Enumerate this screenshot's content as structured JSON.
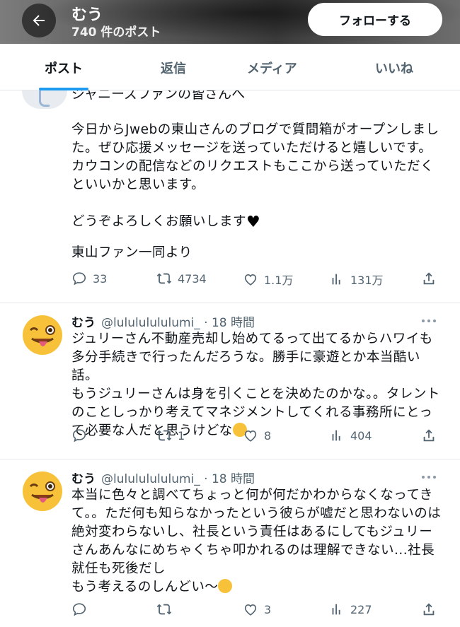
{
  "header": {
    "name": "むう",
    "post_count": "740 件のポスト",
    "follow_label": "フォローする"
  },
  "tabs": [
    "ポスト",
    "返信",
    "メディア",
    "いいね"
  ],
  "tweets": [
    {
      "cut_title": "ジャニーズファンの皆さんへ",
      "text": "今日からJwebの東山さんのブログで質問箱がオープンしました。ぜひ応援メッセージを送っていただけると嬉しいです。カウコンの配信などのリクエストもここから送っていただくといいかと思います。\n\nどうぞよろしくお願いします",
      "text_tail": "東山ファン一同より",
      "replies": "33",
      "reposts": "4734",
      "likes": "1.1万",
      "views": "131万"
    },
    {
      "name": "むう",
      "handle": "@lulululululumi_ · 18 時間",
      "text": "ジュリーさん不動産売却し始めてるって出てるからハワイも多分手続きで行ったんだろうな。勝手に豪遊とか本当酷い話。\nもうジュリーさんは身を引くことを決めたのかな。。タレントのことしっかり考えてマネジメントしてくれる事務所にとって必要な人だと思うけどな",
      "replies": "",
      "reposts": "1",
      "likes": "8",
      "views": "404"
    },
    {
      "name": "むう",
      "handle": "@lulululululumi_ · 18 時間",
      "text": "本当に色々と調べてちょっと何が何だかわからなくなってきて。。ただ何も知らなかったという彼らが嘘だと思わないのは絶対変わらないし、社長という責任はあるにしてもジュリーさんあんなにめちゃくちゃ叩かれるのは理解できない...社長就任も死後だし\nもう考えるのしんどい〜",
      "replies": "",
      "reposts": "",
      "likes": "3",
      "views": "227"
    }
  ],
  "icons": {
    "back": "arrow-left-icon",
    "reply": "reply-icon",
    "repost": "repost-icon",
    "like": "heart-icon",
    "views": "views-icon",
    "share": "share-icon",
    "more": "more-icon"
  },
  "colors": {
    "accent": "#1d9bf0",
    "muted": "#536471"
  }
}
